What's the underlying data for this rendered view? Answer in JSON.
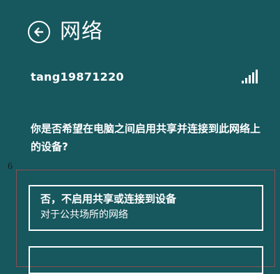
{
  "header": {
    "title": "网络",
    "back_icon": "back-arrow-icon"
  },
  "network": {
    "name": "tang19871220",
    "signal_icon": "signal-strength-icon",
    "signal_level": "5/5"
  },
  "prompt": {
    "question": "你是否希望在电脑之间启用共享并连接到此网络上的设备?"
  },
  "annotation": {
    "marker": "6",
    "color": "#8b4f4f"
  },
  "options": [
    {
      "title": "否，不启用共享或连接到设备",
      "subtitle": "对于公共场所的网络"
    }
  ],
  "colors": {
    "background": "#17575e",
    "text": "#ffffff"
  }
}
